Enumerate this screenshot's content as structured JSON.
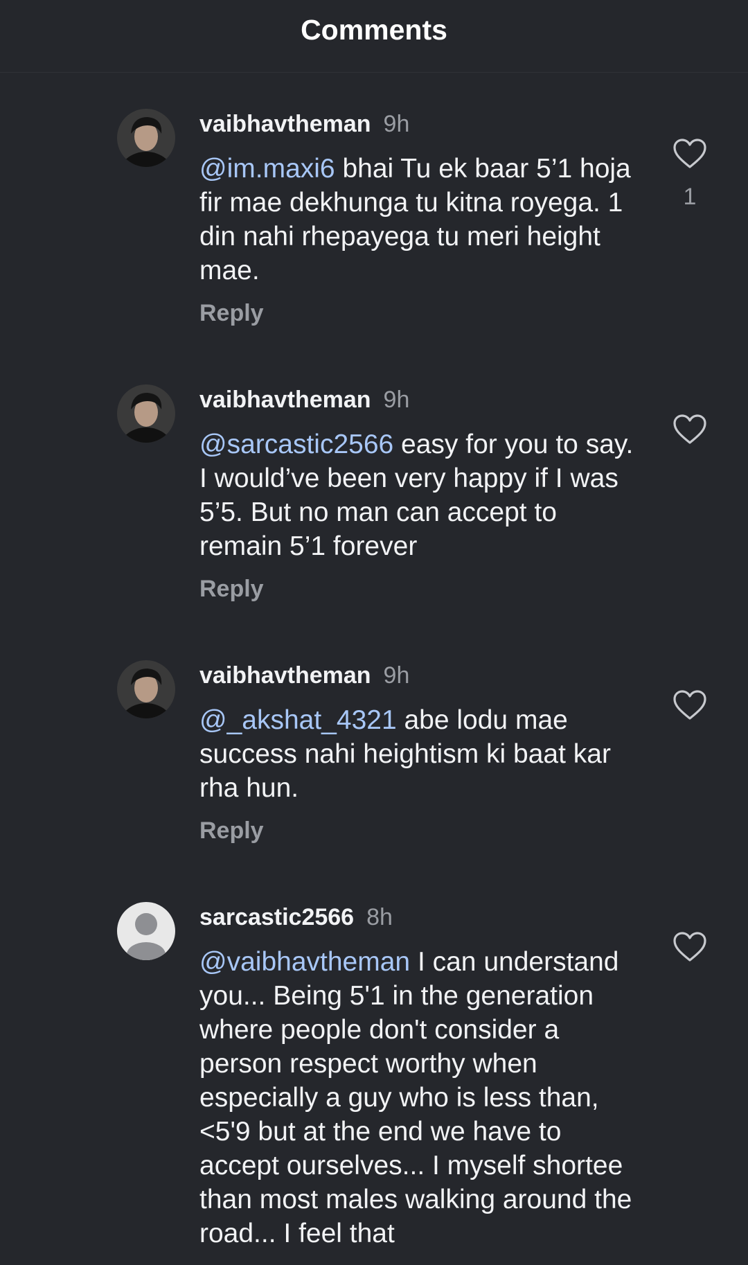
{
  "header": {
    "title": "Comments"
  },
  "icons": {
    "like": "heart-outline-icon",
    "avatar_default": "person-silhouette-icon"
  },
  "comments": [
    {
      "username": "vaibhavtheman",
      "time": "9h",
      "mention": "@im.maxi6",
      "text": " bhai Tu ek baar 5’1 hoja fir mae dekhunga tu kitna royega. 1 din nahi rhepayega tu meri height mae.",
      "reply": "Reply",
      "likes": "1"
    },
    {
      "username": "vaibhavtheman",
      "time": "9h",
      "mention": "@sarcastic2566",
      "text": " easy for you to say. I would’ve been very happy if I was 5’5. But no man can accept to remain  5’1 forever",
      "reply": "Reply"
    },
    {
      "username": "vaibhavtheman",
      "time": "9h",
      "mention": "@_akshat_4321",
      "text": " abe lodu mae success nahi heightism ki baat kar rha hun.",
      "reply": "Reply"
    },
    {
      "username": "sarcastic2566",
      "time": "8h",
      "mention": "@vaibhavtheman",
      "text": " I can understand you... Being 5'1 in the generation where people don't consider a person respect worthy when especially a guy who is less than,<5'9 but at the end we have to accept ourselves... I myself shortee than most males walking around the road... I feel that"
    }
  ],
  "colors": {
    "background": "#25272c",
    "mention": "#a8c7f7",
    "secondary_text": "#9a9da3"
  }
}
